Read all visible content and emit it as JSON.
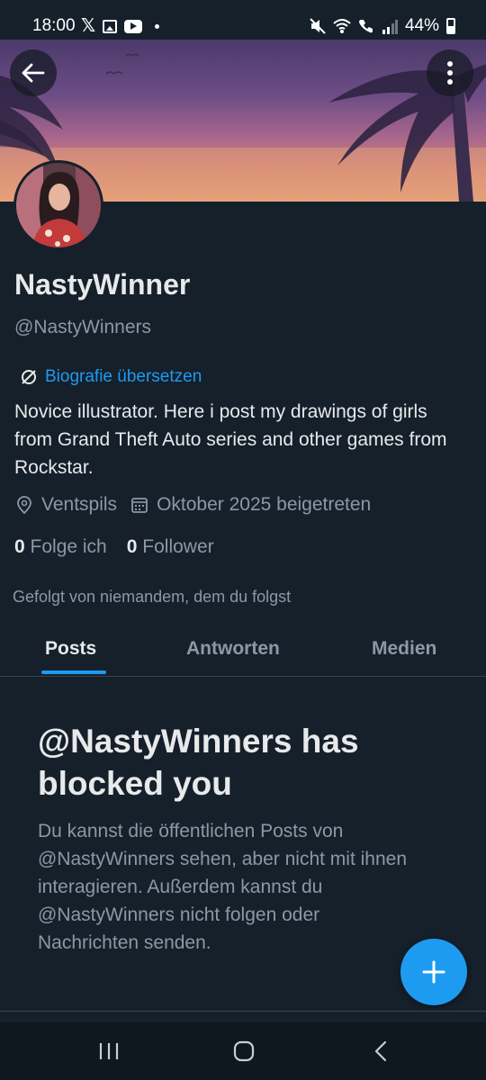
{
  "status_bar": {
    "time": "18:00",
    "battery": "44%",
    "left_icons": [
      "x-icon",
      "image-icon",
      "youtube-icon",
      "dot-icon"
    ],
    "right_icons": [
      "mute-icon",
      "wifi-icon",
      "call-icon",
      "signal-icon",
      "battery-icon"
    ]
  },
  "header": {
    "back_icon": "arrow-left-icon",
    "more_icon": "more-vertical-icon"
  },
  "profile": {
    "name": "NastyWinner",
    "handle": "@NastyWinners",
    "translate_label": "Biografie übersetzen",
    "bio": "Novice illustrator. Here i post my drawings of girls from Grand Theft Auto series and other games from Rockstar.",
    "location": "Ventspils",
    "joined": "Oktober 2025 beigetreten",
    "following_count": "0",
    "following_label": "Folge ich",
    "followers_count": "0",
    "followers_label": "Follower",
    "followed_by": "Gefolgt von niemandem, dem du folgst"
  },
  "tabs": [
    {
      "label": "Posts",
      "active": true
    },
    {
      "label": "Antworten",
      "active": false
    },
    {
      "label": "Medien",
      "active": false
    }
  ],
  "blocked": {
    "title": "@NastyWinners has blocked you",
    "text": "Du kannst die öffentlichen Posts von @NastyWinners sehen, aber nicht mit ihnen interagieren. Außerdem kannst du @NastyWinners nicht folgen oder Nachrichten senden."
  },
  "fab": {
    "icon": "plus-icon"
  },
  "nav": {
    "icons": [
      "recent-apps-icon",
      "home-icon",
      "back-icon"
    ]
  },
  "colors": {
    "background": "#15202b",
    "accent": "#1d9bf0",
    "secondary_text": "#8b98a5",
    "primary_text": "#e7e9ea"
  }
}
